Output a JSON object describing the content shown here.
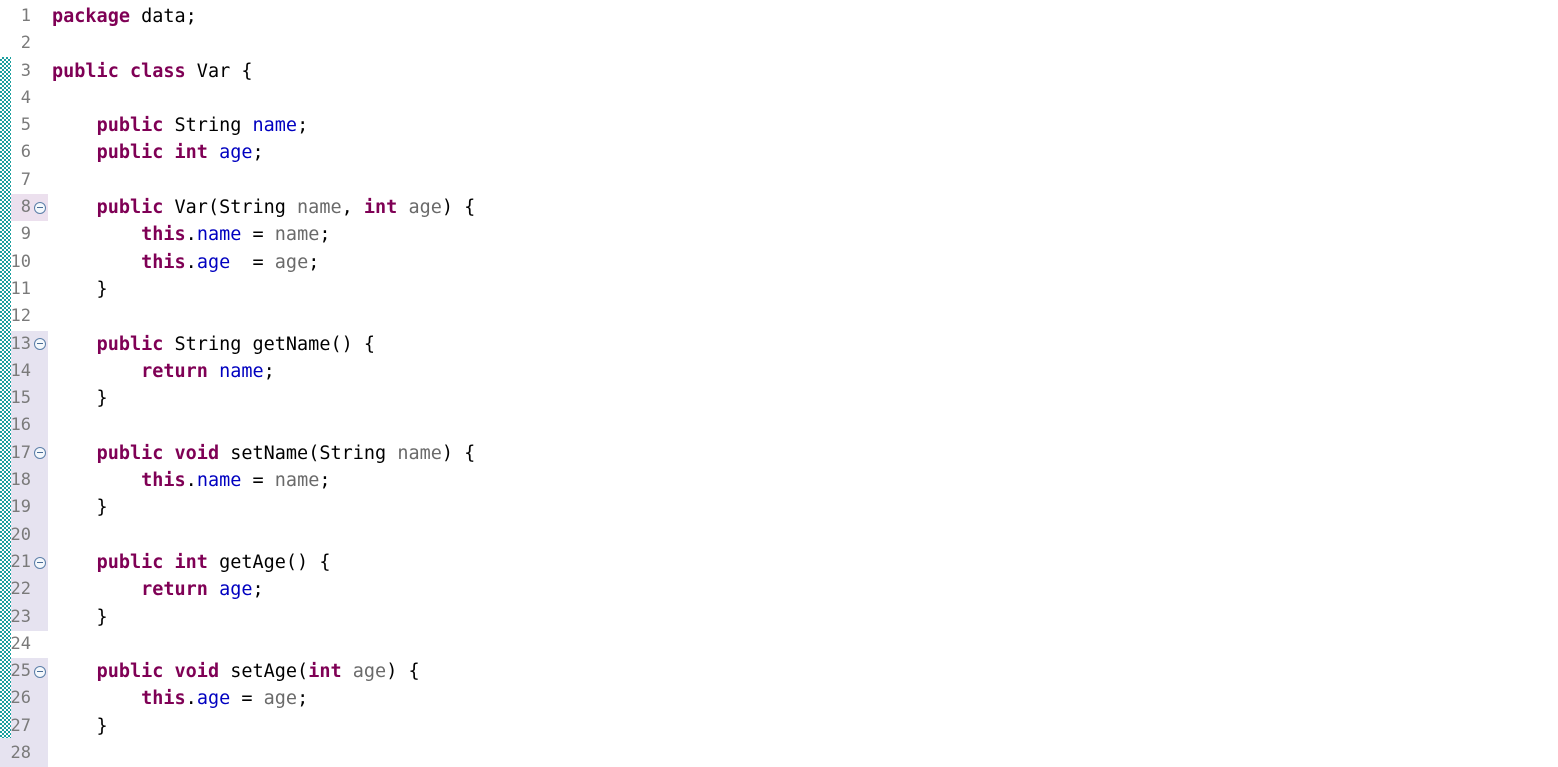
{
  "editor": {
    "language": "java",
    "file_type": "Java source",
    "colors": {
      "keyword": "#7F0055",
      "field": "#0000C0",
      "parameter": "#6A6A6A",
      "plain": "#000000",
      "line_number": "#7A7A7A",
      "gutter_highlight": "#E6E3F0",
      "current_line_highlight": "#ECE0EE",
      "change_bar": "#1A9E9E",
      "background": "#FFFFFF"
    },
    "gutter": {
      "fold_marker_icon": "fold-collapse-icon",
      "fold_marker_lines": [
        8,
        13,
        17,
        21,
        25
      ]
    },
    "lines": [
      {
        "number": "1",
        "highlight": "none",
        "fold": false,
        "tokens": [
          {
            "t": "package",
            "c": "kw"
          },
          {
            "t": " data;",
            "c": "pln"
          }
        ]
      },
      {
        "number": "2",
        "highlight": "none",
        "fold": false,
        "tokens": []
      },
      {
        "number": "3",
        "highlight": "none",
        "fold": false,
        "tokens": [
          {
            "t": "public",
            "c": "kw"
          },
          {
            "t": " ",
            "c": "pln"
          },
          {
            "t": "class",
            "c": "kw"
          },
          {
            "t": " Var {",
            "c": "pln"
          }
        ]
      },
      {
        "number": "4",
        "highlight": "none",
        "fold": false,
        "tokens": []
      },
      {
        "number": "5",
        "highlight": "none",
        "fold": false,
        "tokens": [
          {
            "t": "    ",
            "c": "pln"
          },
          {
            "t": "public",
            "c": "kw"
          },
          {
            "t": " String ",
            "c": "typ"
          },
          {
            "t": "name",
            "c": "fld"
          },
          {
            "t": ";",
            "c": "pln"
          }
        ]
      },
      {
        "number": "6",
        "highlight": "none",
        "fold": false,
        "tokens": [
          {
            "t": "    ",
            "c": "pln"
          },
          {
            "t": "public",
            "c": "kw"
          },
          {
            "t": " ",
            "c": "pln"
          },
          {
            "t": "int",
            "c": "kw"
          },
          {
            "t": " ",
            "c": "pln"
          },
          {
            "t": "age",
            "c": "fld"
          },
          {
            "t": ";",
            "c": "pln"
          }
        ]
      },
      {
        "number": "7",
        "highlight": "none",
        "fold": false,
        "tokens": []
      },
      {
        "number": "8",
        "highlight": "current",
        "fold": true,
        "tokens": [
          {
            "t": "    ",
            "c": "pln"
          },
          {
            "t": "public",
            "c": "kw"
          },
          {
            "t": " Var(String ",
            "c": "typ"
          },
          {
            "t": "name",
            "c": "par"
          },
          {
            "t": ", ",
            "c": "pln"
          },
          {
            "t": "int",
            "c": "kw"
          },
          {
            "t": " ",
            "c": "pln"
          },
          {
            "t": "age",
            "c": "par"
          },
          {
            "t": ") {",
            "c": "pln"
          }
        ]
      },
      {
        "number": "9",
        "highlight": "none",
        "fold": false,
        "tokens": [
          {
            "t": "        ",
            "c": "pln"
          },
          {
            "t": "this",
            "c": "kw"
          },
          {
            "t": ".",
            "c": "pln"
          },
          {
            "t": "name",
            "c": "fld"
          },
          {
            "t": " = ",
            "c": "pln"
          },
          {
            "t": "name",
            "c": "par"
          },
          {
            "t": ";",
            "c": "pln"
          }
        ]
      },
      {
        "number": "10",
        "highlight": "none",
        "fold": false,
        "tokens": [
          {
            "t": "        ",
            "c": "pln"
          },
          {
            "t": "this",
            "c": "kw"
          },
          {
            "t": ".",
            "c": "pln"
          },
          {
            "t": "age",
            "c": "fld"
          },
          {
            "t": "  = ",
            "c": "pln"
          },
          {
            "t": "age",
            "c": "par"
          },
          {
            "t": ";",
            "c": "pln"
          }
        ]
      },
      {
        "number": "11",
        "highlight": "none",
        "fold": false,
        "tokens": [
          {
            "t": "    }",
            "c": "pln"
          }
        ]
      },
      {
        "number": "12",
        "highlight": "none",
        "fold": false,
        "tokens": []
      },
      {
        "number": "13",
        "highlight": "block",
        "fold": true,
        "tokens": [
          {
            "t": "    ",
            "c": "pln"
          },
          {
            "t": "public",
            "c": "kw"
          },
          {
            "t": " String getName() {",
            "c": "typ"
          }
        ]
      },
      {
        "number": "14",
        "highlight": "block",
        "fold": false,
        "tokens": [
          {
            "t": "        ",
            "c": "pln"
          },
          {
            "t": "return",
            "c": "kw"
          },
          {
            "t": " ",
            "c": "pln"
          },
          {
            "t": "name",
            "c": "fld"
          },
          {
            "t": ";",
            "c": "pln"
          }
        ]
      },
      {
        "number": "15",
        "highlight": "block",
        "fold": false,
        "tokens": [
          {
            "t": "    }",
            "c": "pln"
          }
        ]
      },
      {
        "number": "16",
        "highlight": "block",
        "fold": false,
        "tokens": []
      },
      {
        "number": "17",
        "highlight": "block",
        "fold": true,
        "tokens": [
          {
            "t": "    ",
            "c": "pln"
          },
          {
            "t": "public",
            "c": "kw"
          },
          {
            "t": " ",
            "c": "pln"
          },
          {
            "t": "void",
            "c": "kw"
          },
          {
            "t": " setName(String ",
            "c": "typ"
          },
          {
            "t": "name",
            "c": "par"
          },
          {
            "t": ") {",
            "c": "pln"
          }
        ]
      },
      {
        "number": "18",
        "highlight": "block",
        "fold": false,
        "tokens": [
          {
            "t": "        ",
            "c": "pln"
          },
          {
            "t": "this",
            "c": "kw"
          },
          {
            "t": ".",
            "c": "pln"
          },
          {
            "t": "name",
            "c": "fld"
          },
          {
            "t": " = ",
            "c": "pln"
          },
          {
            "t": "name",
            "c": "par"
          },
          {
            "t": ";",
            "c": "pln"
          }
        ]
      },
      {
        "number": "19",
        "highlight": "block",
        "fold": false,
        "tokens": [
          {
            "t": "    }",
            "c": "pln"
          }
        ]
      },
      {
        "number": "20",
        "highlight": "block",
        "fold": false,
        "tokens": []
      },
      {
        "number": "21",
        "highlight": "block",
        "fold": true,
        "tokens": [
          {
            "t": "    ",
            "c": "pln"
          },
          {
            "t": "public",
            "c": "kw"
          },
          {
            "t": " ",
            "c": "pln"
          },
          {
            "t": "int",
            "c": "kw"
          },
          {
            "t": " getAge() {",
            "c": "typ"
          }
        ]
      },
      {
        "number": "22",
        "highlight": "block",
        "fold": false,
        "tokens": [
          {
            "t": "        ",
            "c": "pln"
          },
          {
            "t": "return",
            "c": "kw"
          },
          {
            "t": " ",
            "c": "pln"
          },
          {
            "t": "age",
            "c": "fld"
          },
          {
            "t": ";",
            "c": "pln"
          }
        ]
      },
      {
        "number": "23",
        "highlight": "block",
        "fold": false,
        "tokens": [
          {
            "t": "    }",
            "c": "pln"
          }
        ]
      },
      {
        "number": "24",
        "highlight": "none",
        "fold": false,
        "tokens": []
      },
      {
        "number": "25",
        "highlight": "block",
        "fold": true,
        "tokens": [
          {
            "t": "    ",
            "c": "pln"
          },
          {
            "t": "public",
            "c": "kw"
          },
          {
            "t": " ",
            "c": "pln"
          },
          {
            "t": "void",
            "c": "kw"
          },
          {
            "t": " setAge(",
            "c": "typ"
          },
          {
            "t": "int",
            "c": "kw"
          },
          {
            "t": " ",
            "c": "pln"
          },
          {
            "t": "age",
            "c": "par"
          },
          {
            "t": ") {",
            "c": "pln"
          }
        ]
      },
      {
        "number": "26",
        "highlight": "block",
        "fold": false,
        "tokens": [
          {
            "t": "        ",
            "c": "pln"
          },
          {
            "t": "this",
            "c": "kw"
          },
          {
            "t": ".",
            "c": "pln"
          },
          {
            "t": "age",
            "c": "fld"
          },
          {
            "t": " = ",
            "c": "pln"
          },
          {
            "t": "age",
            "c": "par"
          },
          {
            "t": ";",
            "c": "pln"
          }
        ]
      },
      {
        "number": "27",
        "highlight": "block",
        "fold": false,
        "tokens": [
          {
            "t": "    }",
            "c": "pln"
          }
        ]
      },
      {
        "number": "28",
        "highlight": "block",
        "fold": false,
        "tokens": []
      }
    ]
  }
}
